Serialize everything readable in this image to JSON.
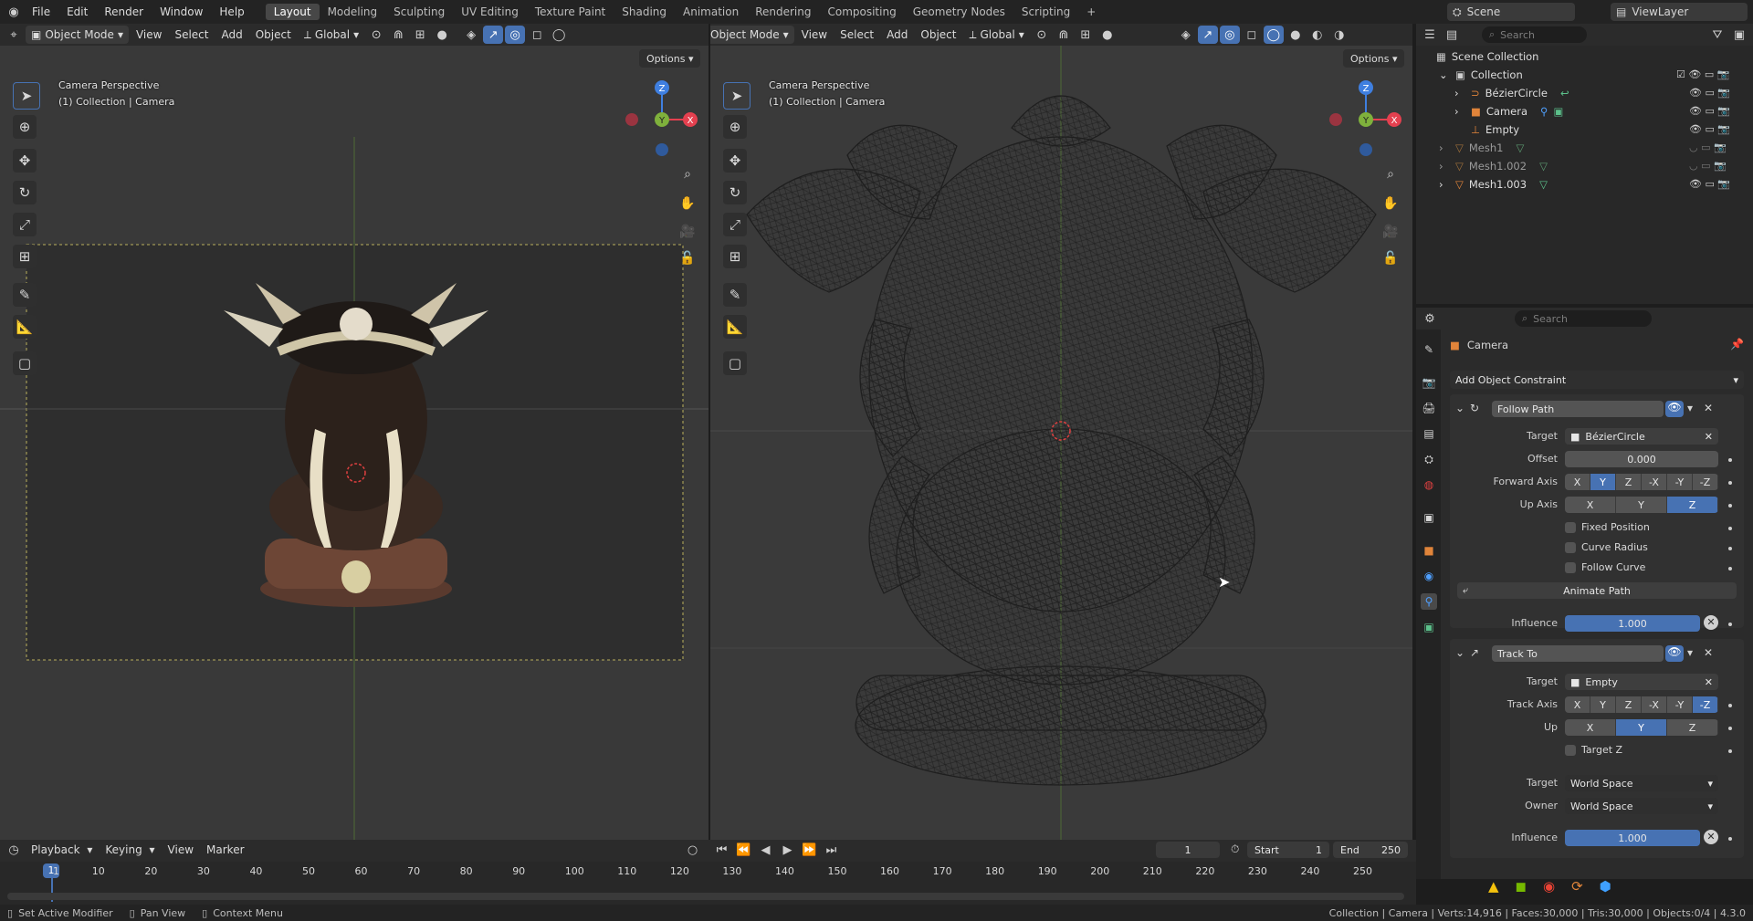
{
  "topbar": {
    "menus": [
      "File",
      "Edit",
      "Render",
      "Window",
      "Help"
    ],
    "workspaces": [
      "Layout",
      "Modeling",
      "Sculpting",
      "UV Editing",
      "Texture Paint",
      "Shading",
      "Animation",
      "Rendering",
      "Compositing",
      "Geometry Nodes",
      "Scripting"
    ],
    "add": "+",
    "scene": "Scene",
    "view_layer": "ViewLayer"
  },
  "viewport_left": {
    "mode": "Object Mode",
    "menus": [
      "View",
      "Select",
      "Add",
      "Object"
    ],
    "transform": "Global",
    "options": "Options",
    "overlay_line1": "Camera Perspective",
    "overlay_line2": "(1) Collection | Camera"
  },
  "viewport_right": {
    "mode": "Object Mode",
    "menus": [
      "View",
      "Select",
      "Add",
      "Object"
    ],
    "transform": "Global",
    "options": "Options",
    "overlay_line1": "Camera Perspective",
    "overlay_line2": "(1) Collection | Camera"
  },
  "gizmo": {
    "z": "Z",
    "x": "X",
    "y": "Y"
  },
  "outliner": {
    "search_placeholder": "Search",
    "root": "Scene Collection",
    "items": [
      {
        "label": "Collection",
        "kind": "collection"
      },
      {
        "label": "BézierCircle",
        "kind": "curve"
      },
      {
        "label": "Camera",
        "kind": "camera"
      },
      {
        "label": "Empty",
        "kind": "empty"
      },
      {
        "label": "Mesh1",
        "kind": "mesh"
      },
      {
        "label": "Mesh1.002",
        "kind": "mesh"
      },
      {
        "label": "Mesh1.003",
        "kind": "mesh"
      }
    ]
  },
  "properties": {
    "search_placeholder": "Search",
    "object_name": "Camera",
    "add_constraint": "Add Object Constraint",
    "follow_path": {
      "name": "Follow Path",
      "target_label": "Target",
      "target": "BézierCircle",
      "offset_label": "Offset",
      "offset": "0.000",
      "forward_label": "Forward Axis",
      "forward_axes": [
        "X",
        "Y",
        "Z",
        "-X",
        "-Y",
        "-Z"
      ],
      "forward_selected": "Y",
      "up_label": "Up Axis",
      "up_axes": [
        "X",
        "Y",
        "Z"
      ],
      "up_selected": "Z",
      "fixed_position": "Fixed Position",
      "curve_radius": "Curve Radius",
      "follow_curve": "Follow Curve",
      "animate_path": "Animate Path",
      "influence_label": "Influence",
      "influence": "1.000"
    },
    "track_to": {
      "name": "Track To",
      "target_label": "Target",
      "target": "Empty",
      "track_label": "Track Axis",
      "track_axes": [
        "X",
        "Y",
        "Z",
        "-X",
        "-Y",
        "-Z"
      ],
      "track_selected": "-Z",
      "up_label": "Up",
      "up_axes": [
        "X",
        "Y",
        "Z"
      ],
      "up_selected": "Y",
      "target_z": "Target Z",
      "target_space_label": "Target",
      "target_space": "World Space",
      "owner_space_label": "Owner",
      "owner_space": "World Space",
      "influence_label": "Influence",
      "influence": "1.000"
    }
  },
  "timeline": {
    "menus": [
      "Playback",
      "Keying",
      "View",
      "Marker"
    ],
    "current_frame": "1",
    "start_label": "Start",
    "start": "1",
    "end_label": "End",
    "end": "250",
    "ticks": [
      "1",
      "10",
      "20",
      "30",
      "40",
      "50",
      "60",
      "70",
      "80",
      "90",
      "100",
      "110",
      "120",
      "130",
      "140",
      "150",
      "160",
      "170",
      "180",
      "190",
      "200",
      "210",
      "220",
      "230",
      "240",
      "250"
    ]
  },
  "status": {
    "left1": "Set Active Modifier",
    "left2": "Pan View",
    "left3": "Context Menu",
    "right": "Collection | Camera | Verts:14,916 | Faces:30,000 | Tris:30,000 | Objects:0/4 | 4.3.0"
  },
  "colors": {
    "accent": "#4772b3",
    "axis_x": "#e4404f",
    "axis_y": "#7fb13c",
    "axis_z": "#3f7fe0"
  }
}
